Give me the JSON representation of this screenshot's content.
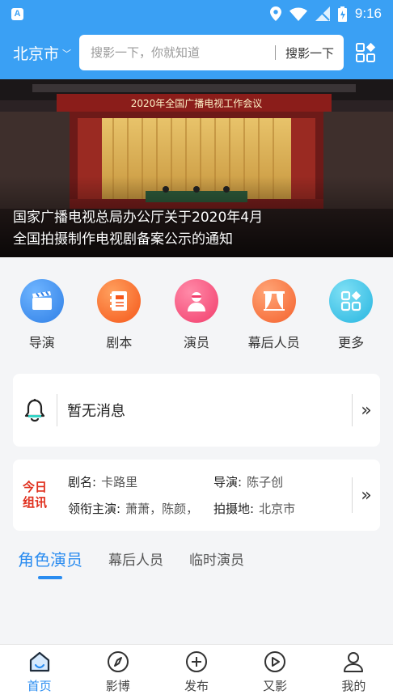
{
  "status_bar": {
    "time": "9:16",
    "app_badge": "A"
  },
  "header": {
    "city": "北京市",
    "search_placeholder": "搜影一下，你就知道",
    "search_button": "搜影一下"
  },
  "banner": {
    "stage_title": "2020年全国广播电视工作会议",
    "caption_line1": "国家广播电视总局办公厅关于2020年4月",
    "caption_line2": "全国拍摄制作电视剧备案公示的通知"
  },
  "quick_entries": [
    {
      "label": "导演",
      "icon": "clapperboard-icon",
      "color": "#3a8ef0"
    },
    {
      "label": "剧本",
      "icon": "script-book-icon",
      "color": "#ff6a2a"
    },
    {
      "label": "演员",
      "icon": "actor-icon",
      "color": "#ff4f7a"
    },
    {
      "label": "幕后人员",
      "icon": "curtain-icon",
      "color": "#ff7a3c"
    },
    {
      "label": "更多",
      "icon": "grid-more-icon",
      "color": "#35c4e8"
    }
  ],
  "notice": {
    "text": "暂无消息",
    "more": "»"
  },
  "today_crew": {
    "logo_line1": "今日",
    "logo_line2": "组讯",
    "drama_label": "剧名:",
    "drama_value": "卡路里",
    "director_label": "导演:",
    "director_value": "陈子创",
    "lead_label": "领衔主演:",
    "lead_value": "萧萧，陈颜，",
    "location_label": "拍摄地:",
    "location_value": "北京市",
    "more": "»"
  },
  "tabs": [
    {
      "label": "角色演员",
      "active": true
    },
    {
      "label": "幕后人员",
      "active": false
    },
    {
      "label": "临时演员",
      "active": false
    }
  ],
  "bottom_nav": [
    {
      "label": "首页",
      "icon": "home-icon",
      "active": true
    },
    {
      "label": "影博",
      "icon": "compass-icon",
      "active": false
    },
    {
      "label": "发布",
      "icon": "publish-plus-icon",
      "active": false
    },
    {
      "label": "又影",
      "icon": "play-icon",
      "active": false
    },
    {
      "label": "我的",
      "icon": "profile-icon",
      "active": false
    }
  ],
  "colors": {
    "primary": "#3aa0f4",
    "accent": "#2a8cf0",
    "today_red": "#e0301e"
  }
}
